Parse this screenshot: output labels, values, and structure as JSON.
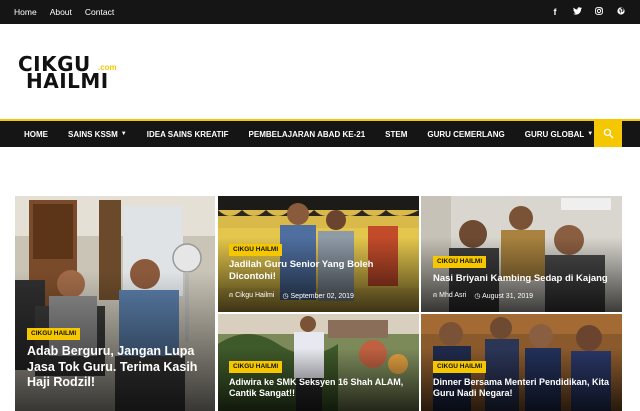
{
  "topbar": {
    "links": [
      "Home",
      "About",
      "Contact"
    ],
    "social": [
      "facebook-icon",
      "twitter-icon",
      "instagram-icon",
      "pinterest-icon"
    ]
  },
  "logo": {
    "line1": "CIKGU",
    "line2": "HAILMI",
    "suffix": ".com"
  },
  "nav": {
    "items": [
      {
        "label": "HOME",
        "has_dropdown": false
      },
      {
        "label": "SAINS KSSM",
        "has_dropdown": true
      },
      {
        "label": "IDEA SAINS KREATIF",
        "has_dropdown": false
      },
      {
        "label": "PEMBELAJARAN ABAD KE-21",
        "has_dropdown": false
      },
      {
        "label": "STEM",
        "has_dropdown": false
      },
      {
        "label": "GURU CEMERLANG",
        "has_dropdown": false
      },
      {
        "label": "GURU GLOBAL",
        "has_dropdown": true
      }
    ],
    "search_icon": "search-icon"
  },
  "posts": {
    "featured": {
      "tag": "CIKGU HAILMI",
      "title": "Adab Berguru, Jangan Lupa Jasa Tok Guru. Terima Kasih Haji Rodzil!"
    },
    "p1": {
      "tag": "CIKGU HAILMI",
      "title": "Jadilah Guru Senior Yang Boleh Dicontohi!",
      "author": "Cikgu Hailmi",
      "date": "September 02, 2019"
    },
    "p2": {
      "tag": "CIKGU HAILMI",
      "title": "Nasi Briyani Kambing Sedap di Kajang",
      "author": "Mhd Asri",
      "date": "August 31, 2019"
    },
    "p3": {
      "tag": "CIKGU HAILMI",
      "title": "Adiwira ke SMK Seksyen 16 Shah ALAM, Cantik Sangat!!"
    },
    "p4": {
      "tag": "CIKGU HAILMI",
      "title": "Dinner Bersama Menteri Pendidikan, Kita Guru Nadi Negara!"
    }
  },
  "colors": {
    "accent": "#f5c700",
    "dark": "#151515"
  }
}
